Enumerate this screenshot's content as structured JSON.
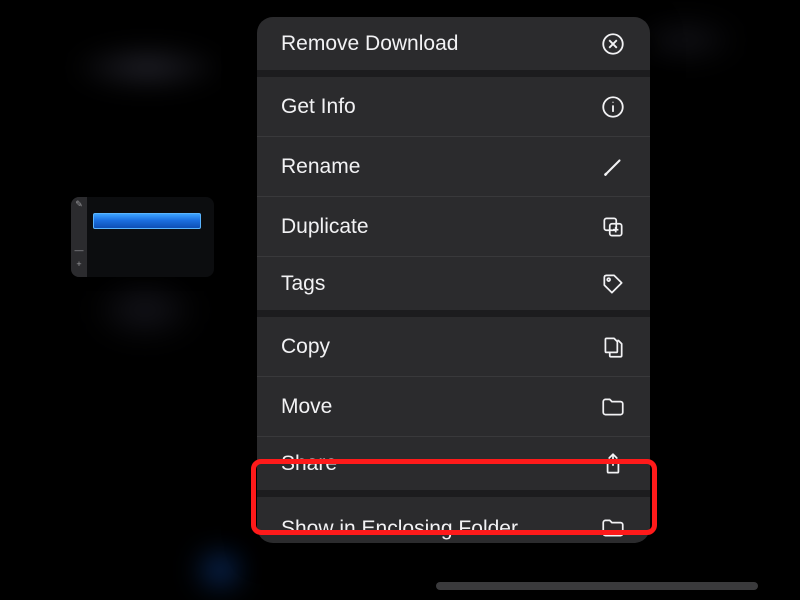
{
  "menu": {
    "remove_download": "Remove Download",
    "get_info": "Get Info",
    "rename": "Rename",
    "duplicate": "Duplicate",
    "tags": "Tags",
    "copy": "Copy",
    "move": "Move",
    "share": "Share",
    "show_enclosing": "Show in Enclosing Folder"
  }
}
